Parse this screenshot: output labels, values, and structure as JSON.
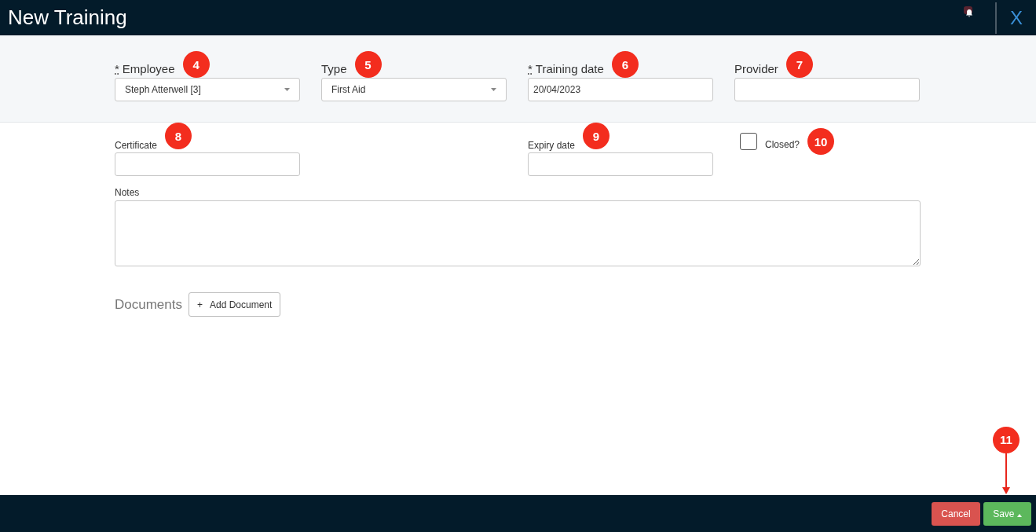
{
  "window": {
    "title": "New Training",
    "close_label": "X"
  },
  "top_fields": [
    {
      "label": "Employee",
      "required_mark": "*",
      "kind": "select",
      "value": "Steph Atterwell [3]",
      "badge": "4"
    },
    {
      "label": "Type",
      "kind": "select",
      "value": "First Aid",
      "badge": "5"
    },
    {
      "label": "Training date",
      "required_mark": "*",
      "kind": "text",
      "value": "20/04/2023",
      "badge": "6"
    },
    {
      "label": "Provider",
      "kind": "text",
      "badge": "7"
    }
  ],
  "certificate": {
    "label": "Certificate",
    "badge": "8"
  },
  "expiry": {
    "label": "Expiry date",
    "badge": "9"
  },
  "closed": {
    "label": "Closed?",
    "checked": false,
    "badge": "10"
  },
  "notes": {
    "label": "Notes"
  },
  "documents": {
    "label": "Documents",
    "button": "Add Document",
    "button_icon": "+"
  },
  "footer": {
    "cancel": "Cancel",
    "save": "Save",
    "save_badge": "11"
  }
}
